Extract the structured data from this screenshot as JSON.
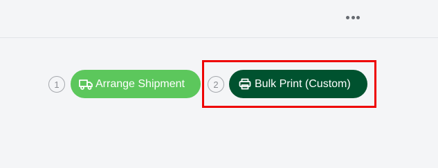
{
  "colors": {
    "background": "#f4f5f7",
    "step_1_button": "#5cc75c",
    "step_2_button": "#00522f",
    "highlight": "#ee0000"
  },
  "toolbar": {
    "more_icon": "more-horizontal-icon"
  },
  "steps": [
    {
      "number": "1",
      "icon": "truck-icon",
      "label": "Arrange Shipment"
    },
    {
      "number": "2",
      "icon": "printer-icon",
      "label": "Bulk Print (Custom)"
    }
  ]
}
